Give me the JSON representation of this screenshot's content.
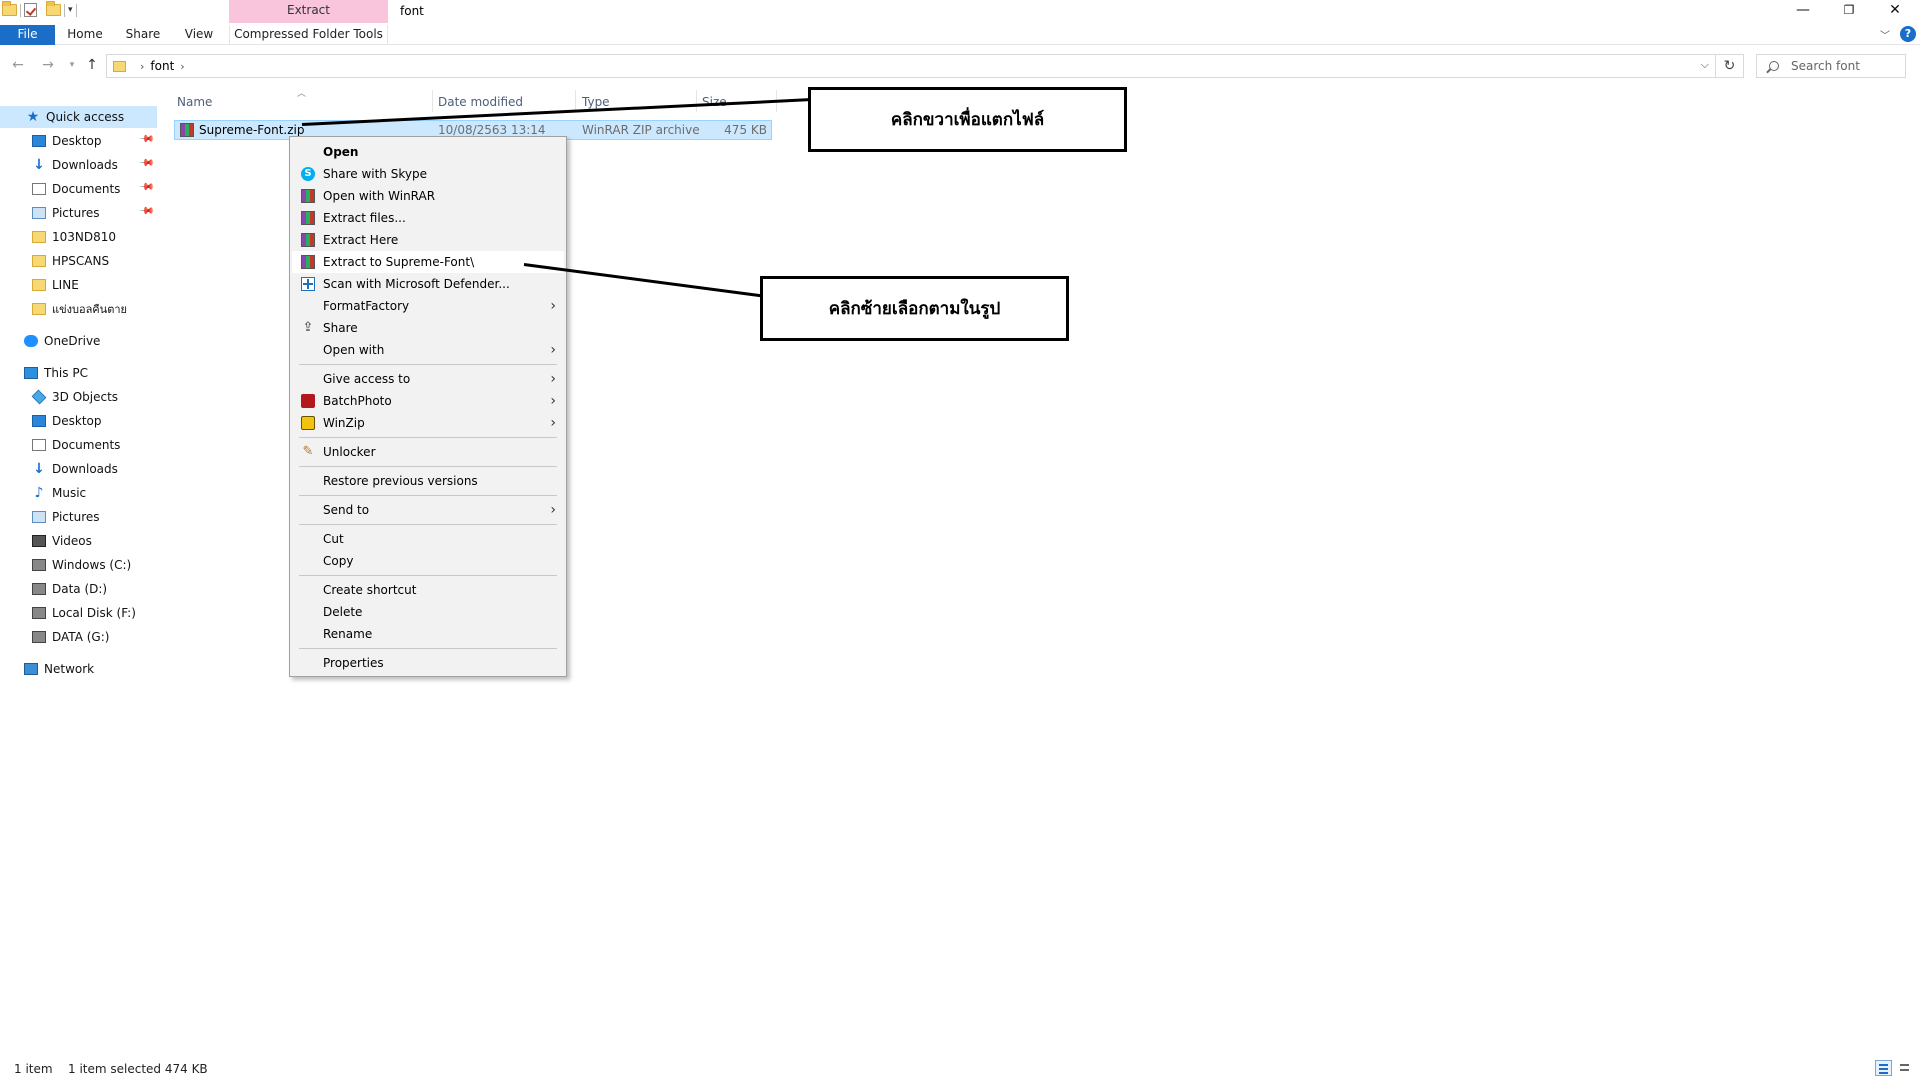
{
  "window": {
    "title": "font",
    "context_tab": "Extract",
    "controls": [
      "—",
      "❐",
      "✕"
    ]
  },
  "ribbon": {
    "tabs": [
      "File",
      "Home",
      "Share",
      "View",
      "Compressed Folder Tools"
    ]
  },
  "address": {
    "crumbs": [
      "font"
    ],
    "search_placeholder": "Search font"
  },
  "nav": {
    "quick_access": "Quick access",
    "quick_items": [
      "Desktop",
      "Downloads",
      "Documents",
      "Pictures",
      "103ND810",
      "HPSCANS",
      "LINE",
      "แข่งบอลคืนตาย"
    ],
    "onedrive": "OneDrive",
    "this_pc": "This PC",
    "pc_items": [
      "3D Objects",
      "Desktop",
      "Documents",
      "Downloads",
      "Music",
      "Pictures",
      "Videos",
      "Windows (C:)",
      "Data (D:)",
      "Local Disk (F:)",
      "DATA (G:)"
    ],
    "network": "Network"
  },
  "columns": {
    "name": "Name",
    "date": "Date modified",
    "type": "Type",
    "size": "Size"
  },
  "file": {
    "name": "Supreme-Font.zip",
    "date": "10/08/2563 13:14",
    "type": "WinRAR ZIP archive",
    "size": "475 KB"
  },
  "menu": {
    "open": "Open",
    "share_skype": "Share with Skype",
    "open_winrar": "Open with WinRAR",
    "extract_files": "Extract files...",
    "extract_here": "Extract Here",
    "extract_to": "Extract to Supreme-Font\\",
    "scan_defender": "Scan with Microsoft Defender...",
    "formatfactory": "FormatFactory",
    "share": "Share",
    "open_with": "Open with",
    "give_access": "Give access to",
    "batchphoto": "BatchPhoto",
    "winzip": "WinZip",
    "unlocker": "Unlocker",
    "restore": "Restore previous versions",
    "send_to": "Send to",
    "cut": "Cut",
    "copy": "Copy",
    "create_shortcut": "Create shortcut",
    "delete": "Delete",
    "rename": "Rename",
    "properties": "Properties"
  },
  "callouts": {
    "right_click": "คลิกขวาเพื่อแตกไฟล์",
    "left_click": "คลิกซ้ายเลือกตามในรูป"
  },
  "status": {
    "count": "1 item",
    "selected": "1 item selected  474 KB"
  },
  "colors": {
    "accent": "#1a6ec7",
    "selection": "#cce8ff",
    "context_tab": "#f9c5dc"
  }
}
